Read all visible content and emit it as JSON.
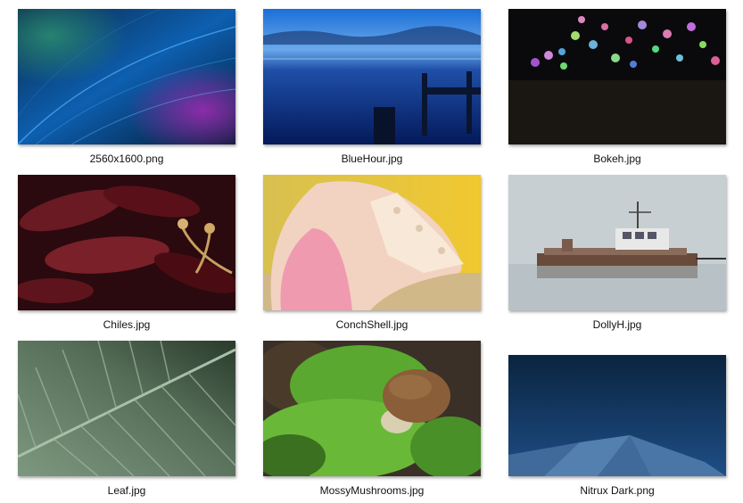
{
  "files": [
    {
      "name": "2560x1600.png"
    },
    {
      "name": "BlueHour.jpg"
    },
    {
      "name": "Bokeh.jpg"
    },
    {
      "name": "Chiles.jpg"
    },
    {
      "name": "ConchShell.jpg"
    },
    {
      "name": "DollyH.jpg"
    },
    {
      "name": "Leaf.jpg"
    },
    {
      "name": "MossyMushrooms.jpg"
    },
    {
      "name": "Nitrux Dark.png"
    }
  ]
}
